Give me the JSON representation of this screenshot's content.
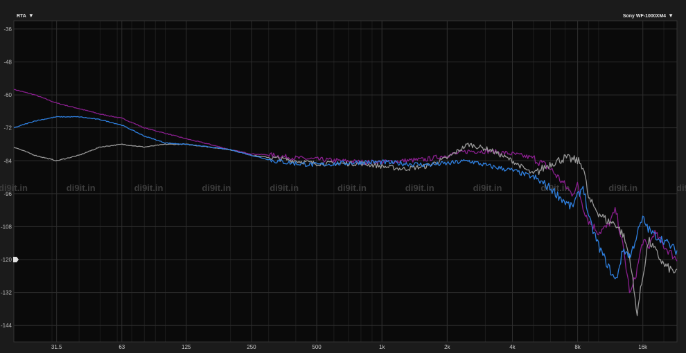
{
  "controls": {
    "mode_label": "RTA",
    "device_label": "Sony WF-1000XM4"
  },
  "watermark": "di9it.in",
  "chart_data": {
    "type": "line",
    "xscale": "log",
    "xlim": [
      20,
      23000
    ],
    "ylim": [
      -150,
      -33
    ],
    "ytick_values": [
      -36,
      -48,
      -60,
      -72,
      -84,
      -96,
      -108,
      -120,
      -132,
      -144
    ],
    "ytick_labels": [
      "-36",
      "-48",
      "-60",
      "-72",
      "-84",
      "-96",
      "-108",
      "-120",
      "-132",
      "-144"
    ],
    "xtick_values": [
      31.5,
      63,
      125,
      250,
      500,
      1000,
      2000,
      4000,
      8000,
      16000
    ],
    "xtick_labels": [
      "31.5",
      "63",
      "125",
      "250",
      "500",
      "1k",
      "2k",
      "4k",
      "8k",
      "16k"
    ],
    "grid": true,
    "series": [
      {
        "color": "#8a1f8f",
        "x": [
          20,
          25,
          31.5,
          40,
          50,
          63,
          80,
          100,
          125,
          160,
          200,
          250,
          315,
          400,
          500,
          630,
          800,
          1000,
          1250,
          1600,
          2000,
          2500,
          3150,
          4000,
          5000,
          6000,
          6500,
          7000,
          7500,
          8000,
          8500,
          9000,
          10000,
          11000,
          12000,
          13000,
          14000,
          15000,
          16000,
          17000,
          18000,
          20000,
          23000
        ],
        "y": [
          -58,
          -60,
          -63,
          -65,
          -67,
          -68.5,
          -72,
          -74,
          -76,
          -78,
          -80,
          -81.5,
          -82,
          -83,
          -83.5,
          -84,
          -84.5,
          -84.5,
          -84,
          -83.5,
          -82,
          -80.5,
          -80.5,
          -81.5,
          -83,
          -87,
          -90,
          -93,
          -96,
          -93,
          -101,
          -106,
          -110,
          -108,
          -102,
          -116,
          -133,
          -124,
          -113,
          -116,
          -110,
          -115,
          -120
        ]
      },
      {
        "color": "#999999",
        "x": [
          20,
          25,
          31.5,
          40,
          50,
          63,
          80,
          100,
          125,
          160,
          200,
          250,
          315,
          400,
          500,
          630,
          800,
          1000,
          1250,
          1600,
          2000,
          2500,
          3150,
          4000,
          5000,
          6000,
          7000,
          8000,
          8500,
          9000,
          10000,
          11000,
          12000,
          13000,
          14000,
          15000,
          16000,
          17000,
          18000,
          20000,
          23000
        ],
        "y": [
          -79,
          -82,
          -84,
          -82,
          -79,
          -78,
          -79,
          -78,
          -78,
          -79,
          -80,
          -82,
          -83,
          -84,
          -85,
          -85,
          -85,
          -86,
          -87,
          -86,
          -83,
          -78,
          -80,
          -84,
          -89,
          -85,
          -83,
          -84,
          -86,
          -98,
          -103,
          -106,
          -107,
          -111,
          -120,
          -140,
          -126,
          -113,
          -116,
          -122,
          -125
        ]
      },
      {
        "color": "#2f80e0",
        "x": [
          20,
          25,
          31.5,
          40,
          50,
          63,
          80,
          100,
          125,
          160,
          200,
          250,
          315,
          400,
          500,
          630,
          800,
          1000,
          1250,
          1600,
          2000,
          2500,
          3150,
          4000,
          5000,
          6000,
          7000,
          7500,
          8000,
          8500,
          9000,
          10000,
          11000,
          12000,
          13000,
          14000,
          15000,
          16000,
          17000,
          18000,
          20000,
          23000
        ],
        "y": [
          -72,
          -69.5,
          -68,
          -68,
          -69,
          -71,
          -75,
          -77.5,
          -78,
          -79,
          -80,
          -82,
          -84,
          -85,
          -85.5,
          -85,
          -84.5,
          -84.5,
          -85,
          -85.5,
          -85,
          -84,
          -86,
          -87.5,
          -90,
          -94,
          -99,
          -101,
          -97,
          -93,
          -105,
          -115,
          -122,
          -128,
          -116,
          -119,
          -111,
          -105,
          -109,
          -111,
          -113,
          -117
        ]
      }
    ]
  }
}
